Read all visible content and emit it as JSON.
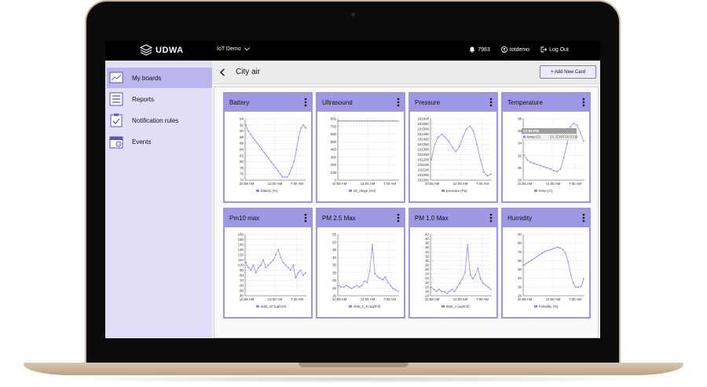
{
  "app": {
    "brand": "UDWA",
    "board_selector": "IoT Demo",
    "notifications_count": "7983",
    "user": "totdemo",
    "logout": "Log Out"
  },
  "sidebar": {
    "items": [
      {
        "label": "My boards",
        "icon": "chart-board-icon",
        "active": true
      },
      {
        "label": "Reports",
        "icon": "list-report-icon",
        "active": false
      },
      {
        "label": "Notification rules",
        "icon": "clipboard-check-icon",
        "active": false
      },
      {
        "label": "Events",
        "icon": "calendar-icon",
        "active": false
      }
    ]
  },
  "page": {
    "title": "City air",
    "add_card_label": "+ Add New Card"
  },
  "colors": {
    "accent": "#9d99e5",
    "sidebar_bg": "#e1dff8",
    "sidebar_active": "#b9b6ec",
    "line": "#8f8be0"
  },
  "cards": [
    {
      "title": "Battery"
    },
    {
      "title": "Ultrasound"
    },
    {
      "title": "Pressure"
    },
    {
      "title": "Temperature"
    },
    {
      "title": "Pm10 max"
    },
    {
      "title": "PM 2.5 Max"
    },
    {
      "title": "PM 1.0 Max"
    },
    {
      "title": "Humidity"
    }
  ],
  "chart_data": [
    {
      "type": "line",
      "title": "Battery",
      "x_ticks": [
        "10:58 AM",
        "12:00 AM",
        "7:00 AM"
      ],
      "y_ticks": [
        "94",
        "92",
        "90",
        "88",
        "86",
        "84",
        "82",
        "80",
        "78",
        "76",
        "74"
      ],
      "ylim": [
        74,
        94
      ],
      "series": [
        {
          "name": "battery (%)",
          "values": [
            92,
            90,
            89,
            88,
            87,
            86,
            85,
            84,
            83,
            82,
            81,
            80,
            79,
            78,
            77,
            76,
            75,
            75,
            75,
            76,
            78,
            80,
            84,
            88,
            91,
            92,
            91
          ]
        }
      ]
    },
    {
      "type": "line",
      "title": "Ultrasound",
      "x_ticks": [
        "10:58 AM",
        "12:00 AM",
        "7:00 AM"
      ],
      "y_ticks": [
        "800",
        "700",
        "600",
        "500",
        "400",
        "300",
        "200",
        "100",
        "0"
      ],
      "ylim": [
        0,
        800
      ],
      "series": [
        {
          "name": "ult_range (cm)",
          "values": [
            770,
            772,
            771,
            770,
            772,
            773,
            771,
            770,
            772,
            771,
            770,
            772,
            771,
            770,
            773,
            772,
            771,
            770,
            772,
            771,
            770,
            772,
            771,
            770
          ]
        }
      ]
    },
    {
      "type": "line",
      "title": "Pressure",
      "x_ticks": [
        "10:58 AM",
        "12:00 AM",
        "7:00 AM"
      ],
      "y_ticks": [
        "101600",
        "101550",
        "101500",
        "101450",
        "101400",
        "101350",
        "101300",
        "101250",
        "101200",
        "101150",
        "101100",
        "101050",
        "101000"
      ],
      "ylim": [
        101000,
        101600
      ],
      "series": [
        {
          "name": "pressure (Pa)",
          "values": [
            101200,
            101350,
            101420,
            101450,
            101420,
            101380,
            101320,
            101280,
            101330,
            101420,
            101500,
            101530,
            101480,
            101350,
            101200,
            101080,
            101040,
            101060
          ]
        }
      ]
    },
    {
      "type": "line",
      "title": "Temperature",
      "x_ticks": [
        "10:58 AM",
        "12:00 AM",
        "7:00 AM"
      ],
      "y_ticks": [
        "38",
        "36",
        "34",
        "32",
        "30",
        "28"
      ],
      "ylim": [
        27,
        38
      ],
      "tooltip": {
        "time": "12:00 PM",
        "label": "temp (C)",
        "value": "29.323833333333"
      },
      "series": [
        {
          "name": "temp (C)",
          "values": [
            31.5,
            30.6,
            30.2,
            30.0,
            29.8,
            29.6,
            29.4,
            29.2,
            29.0,
            28.7,
            28.5,
            29.0,
            31.0,
            33.5,
            36.5,
            37.2,
            36.8,
            35.5,
            34.0
          ]
        }
      ]
    },
    {
      "type": "line",
      "title": "Pm10 max",
      "x_ticks": [
        "10:58 AM",
        "12:00 AM",
        "7:00 AM"
      ],
      "y_ticks": [
        "160",
        "150",
        "140",
        "130",
        "120",
        "110",
        "100",
        "90",
        "80",
        "70",
        "60",
        "50",
        "40"
      ],
      "ylim": [
        40,
        160
      ],
      "series": [
        {
          "name": "dust_10 (ug/m3)",
          "values": [
            105,
            95,
            90,
            100,
            85,
            95,
            100,
            110,
            95,
            100,
            105,
            110,
            120,
            130,
            115,
            105,
            100,
            95,
            90,
            100,
            75,
            85,
            90,
            80,
            85
          ]
        }
      ]
    },
    {
      "type": "line",
      "title": "PM 2.5 Max",
      "x_ticks": [
        "10:58 AM",
        "12:00 AM",
        "7:00 AM"
      ],
      "y_ticks": [
        "55",
        "50",
        "45",
        "40",
        "35",
        "30",
        "25",
        "20",
        "15"
      ],
      "ylim": [
        15,
        57
      ],
      "series": [
        {
          "name": "dust_2_5 (ug/m3)",
          "values": [
            22,
            21,
            21,
            22,
            21,
            20,
            21,
            22,
            21,
            22,
            25,
            24,
            32,
            50,
            30,
            28,
            27,
            26,
            28,
            24,
            22,
            20,
            19,
            18
          ]
        }
      ]
    },
    {
      "type": "line",
      "title": "PM 1.0 Max",
      "x_ticks": [
        "10:58 AM",
        "12:00 AM",
        "7:00 AM"
      ],
      "y_ticks": [
        "42",
        "40",
        "38",
        "36",
        "34",
        "32",
        "30",
        "28",
        "26",
        "24",
        "22",
        "20",
        "18",
        "16",
        "14"
      ],
      "ylim": [
        14,
        43
      ],
      "series": [
        {
          "name": "dust_1 (ug/m3)",
          "values": [
            18,
            17,
            16,
            17,
            16,
            16,
            15,
            16,
            17,
            16,
            18,
            20,
            22,
            25,
            38,
            24,
            22,
            24,
            27,
            22,
            20,
            19,
            18,
            17
          ]
        }
      ]
    },
    {
      "type": "line",
      "title": "Humidity",
      "x_ticks": [
        "10:58 AM",
        "12:00 AM",
        "7:00 AM"
      ],
      "y_ticks": [
        "90",
        "80",
        "70",
        "60",
        "50",
        "40",
        "30",
        "20"
      ],
      "ylim": [
        20,
        92
      ],
      "series": [
        {
          "name": "humidity (%)",
          "values": [
            56,
            58,
            60,
            62,
            64,
            66,
            68,
            70,
            72,
            73,
            74,
            75,
            76,
            77,
            76,
            74,
            70,
            60,
            45,
            35,
            30,
            30,
            31,
            40
          ]
        }
      ]
    }
  ]
}
